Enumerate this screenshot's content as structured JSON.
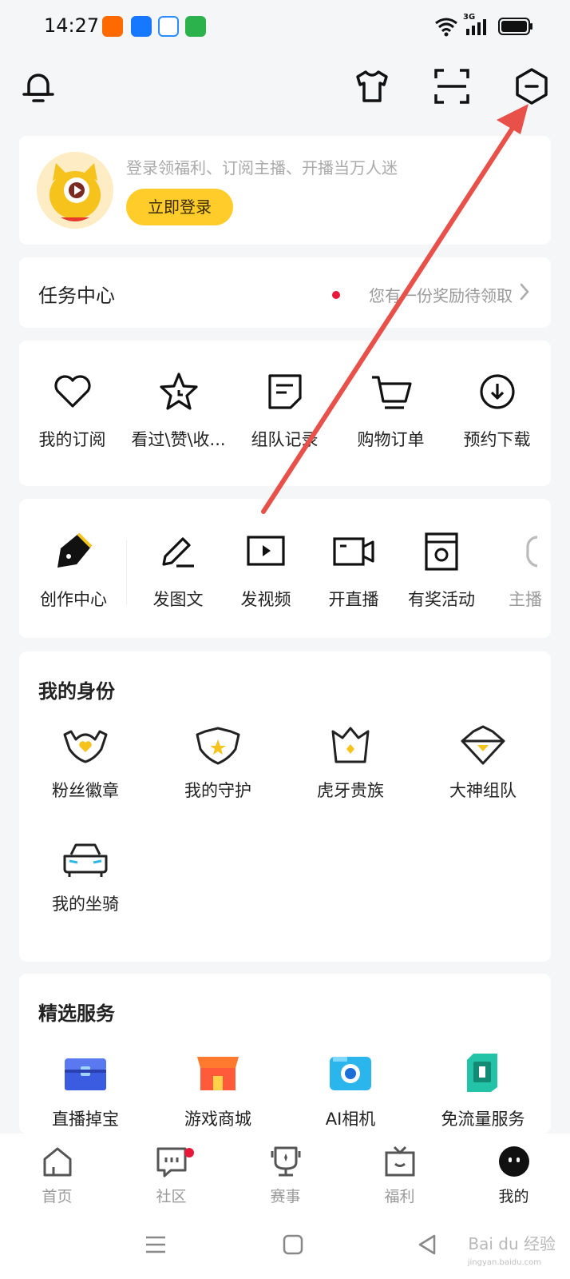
{
  "status_bar": {
    "time": "14:27",
    "network": "3G",
    "app_icons": [
      "taobao-icon",
      "alipay-icon",
      "qq-browser-icon",
      "wechat-icon"
    ]
  },
  "header": {
    "icons": [
      "bell-icon",
      "tshirt-icon",
      "scan-icon",
      "settings-hexagon-icon"
    ]
  },
  "login": {
    "tip": "登录领福利、订阅主播、开播当万人迷",
    "button_label": "立即登录"
  },
  "task_center": {
    "title": "任务中心",
    "note": "您有一份奖励待领取"
  },
  "quick_actions": [
    {
      "label": "我的订阅",
      "icon": "heart-icon"
    },
    {
      "label": "看过\\赞\\收...",
      "icon": "star-icon"
    },
    {
      "label": "组队记录",
      "icon": "team-record-icon"
    },
    {
      "label": "购物订单",
      "icon": "cart-icon"
    },
    {
      "label": "预约下载",
      "icon": "download-icon"
    }
  ],
  "creator": [
    {
      "label": "创作中心",
      "icon": "pen-nib-icon"
    },
    {
      "label": "发图文",
      "icon": "edit-icon"
    },
    {
      "label": "发视频",
      "icon": "video-play-icon"
    },
    {
      "label": "开直播",
      "icon": "camera-icon"
    },
    {
      "label": "有奖活动",
      "icon": "prize-icon"
    },
    {
      "label": "主播",
      "icon": "anchor-icon"
    }
  ],
  "identity": {
    "title": "我的身份",
    "items": [
      {
        "label": "粉丝徽章",
        "icon": "fan-badge-icon"
      },
      {
        "label": "我的守护",
        "icon": "guard-shield-icon"
      },
      {
        "label": "虎牙贵族",
        "icon": "noble-crown-icon"
      },
      {
        "label": "大神组队",
        "icon": "master-team-icon"
      },
      {
        "label": "我的坐骑",
        "icon": "car-mount-icon"
      }
    ]
  },
  "services": {
    "title": "精选服务",
    "items": [
      {
        "label": "直播掉宝",
        "icon": "treasure-chest-icon"
      },
      {
        "label": "游戏商城",
        "icon": "game-shop-icon"
      },
      {
        "label": "AI相机",
        "icon": "ai-camera-icon"
      },
      {
        "label": "免流量服务",
        "icon": "sim-card-icon"
      }
    ]
  },
  "tabs": [
    {
      "label": "首页",
      "icon": "home-icon"
    },
    {
      "label": "社区",
      "icon": "community-icon"
    },
    {
      "label": "赛事",
      "icon": "trophy-icon"
    },
    {
      "label": "福利",
      "icon": "welfare-tv-icon"
    },
    {
      "label": "我的",
      "icon": "me-icon"
    }
  ],
  "colors": {
    "accent_yellow": "#ffcc2a",
    "badge_red": "#e8183a",
    "annotation_red": "#e8504a",
    "background": "#f5f6f8"
  },
  "watermark": {
    "text": "Bai du 经验",
    "sub": "jingyan.baidu.com"
  }
}
